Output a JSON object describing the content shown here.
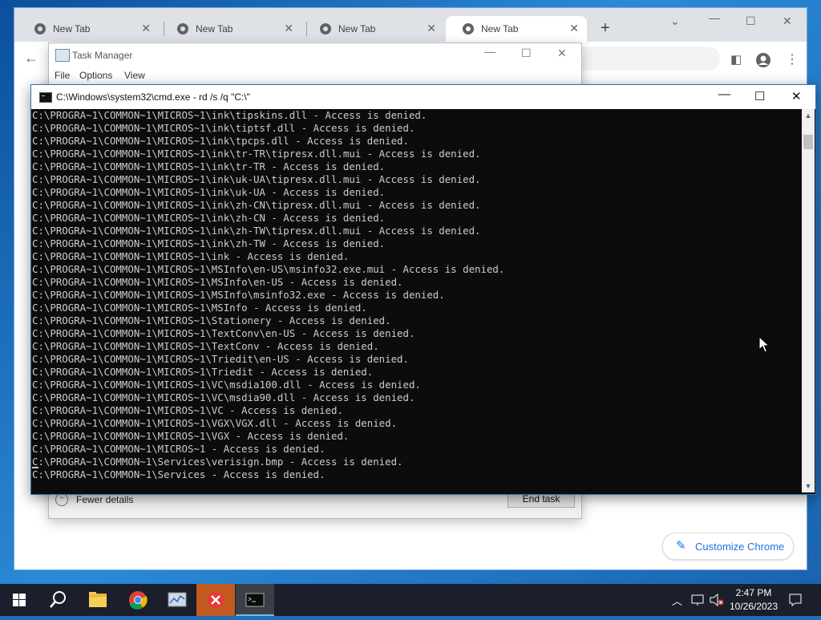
{
  "chrome": {
    "tabs": [
      {
        "label": "New Tab"
      },
      {
        "label": "New Tab"
      },
      {
        "label": "New Tab"
      },
      {
        "label": "New Tab"
      }
    ],
    "new_tab_symbol": "+",
    "customize_label": "Customize Chrome"
  },
  "task_manager": {
    "title": "Task Manager",
    "menu": [
      "File",
      "Options",
      "View"
    ],
    "fewer_details": "Fewer details",
    "end_task": "End task"
  },
  "cmd": {
    "title": "C:\\Windows\\system32\\cmd.exe - rd  /s /q \"C:\\\"",
    "lines": [
      "C:\\PROGRA~1\\COMMON~1\\MICROS~1\\ink\\tipskins.dll - Access is denied.",
      "C:\\PROGRA~1\\COMMON~1\\MICROS~1\\ink\\tiptsf.dll - Access is denied.",
      "C:\\PROGRA~1\\COMMON~1\\MICROS~1\\ink\\tpcps.dll - Access is denied.",
      "C:\\PROGRA~1\\COMMON~1\\MICROS~1\\ink\\tr-TR\\tipresx.dll.mui - Access is denied.",
      "C:\\PROGRA~1\\COMMON~1\\MICROS~1\\ink\\tr-TR - Access is denied.",
      "C:\\PROGRA~1\\COMMON~1\\MICROS~1\\ink\\uk-UA\\tipresx.dll.mui - Access is denied.",
      "C:\\PROGRA~1\\COMMON~1\\MICROS~1\\ink\\uk-UA - Access is denied.",
      "C:\\PROGRA~1\\COMMON~1\\MICROS~1\\ink\\zh-CN\\tipresx.dll.mui - Access is denied.",
      "C:\\PROGRA~1\\COMMON~1\\MICROS~1\\ink\\zh-CN - Access is denied.",
      "C:\\PROGRA~1\\COMMON~1\\MICROS~1\\ink\\zh-TW\\tipresx.dll.mui - Access is denied.",
      "C:\\PROGRA~1\\COMMON~1\\MICROS~1\\ink\\zh-TW - Access is denied.",
      "C:\\PROGRA~1\\COMMON~1\\MICROS~1\\ink - Access is denied.",
      "C:\\PROGRA~1\\COMMON~1\\MICROS~1\\MSInfo\\en-US\\msinfo32.exe.mui - Access is denied.",
      "C:\\PROGRA~1\\COMMON~1\\MICROS~1\\MSInfo\\en-US - Access is denied.",
      "C:\\PROGRA~1\\COMMON~1\\MICROS~1\\MSInfo\\msinfo32.exe - Access is denied.",
      "C:\\PROGRA~1\\COMMON~1\\MICROS~1\\MSInfo - Access is denied.",
      "C:\\PROGRA~1\\COMMON~1\\MICROS~1\\Stationery - Access is denied.",
      "C:\\PROGRA~1\\COMMON~1\\MICROS~1\\TextConv\\en-US - Access is denied.",
      "C:\\PROGRA~1\\COMMON~1\\MICROS~1\\TextConv - Access is denied.",
      "C:\\PROGRA~1\\COMMON~1\\MICROS~1\\Triedit\\en-US - Access is denied.",
      "C:\\PROGRA~1\\COMMON~1\\MICROS~1\\Triedit - Access is denied.",
      "C:\\PROGRA~1\\COMMON~1\\MICROS~1\\VC\\msdia100.dll - Access is denied.",
      "C:\\PROGRA~1\\COMMON~1\\MICROS~1\\VC\\msdia90.dll - Access is denied.",
      "C:\\PROGRA~1\\COMMON~1\\MICROS~1\\VC - Access is denied.",
      "C:\\PROGRA~1\\COMMON~1\\MICROS~1\\VGX\\VGX.dll - Access is denied.",
      "C:\\PROGRA~1\\COMMON~1\\MICROS~1\\VGX - Access is denied.",
      "C:\\PROGRA~1\\COMMON~1\\MICROS~1 - Access is denied.",
      "C:\\PROGRA~1\\COMMON~1\\Services\\verisign.bmp - Access is denied.",
      "C:\\PROGRA~1\\COMMON~1\\Services - Access is denied."
    ]
  },
  "taskbar": {
    "icons": [
      "windows-start-icon",
      "search-icon",
      "file-explorer-icon",
      "chrome-icon",
      "task-manager-icon",
      "red-x-app-icon",
      "cmd-icon"
    ],
    "clock": {
      "time": "2:47 PM",
      "date": "10/26/2023"
    }
  },
  "colors": {
    "cmd_bg": "#0c0c0c",
    "cmd_text": "#cccccc",
    "chrome_accent": "#1a73e8",
    "taskbar_bg": "#1a1f2b"
  }
}
